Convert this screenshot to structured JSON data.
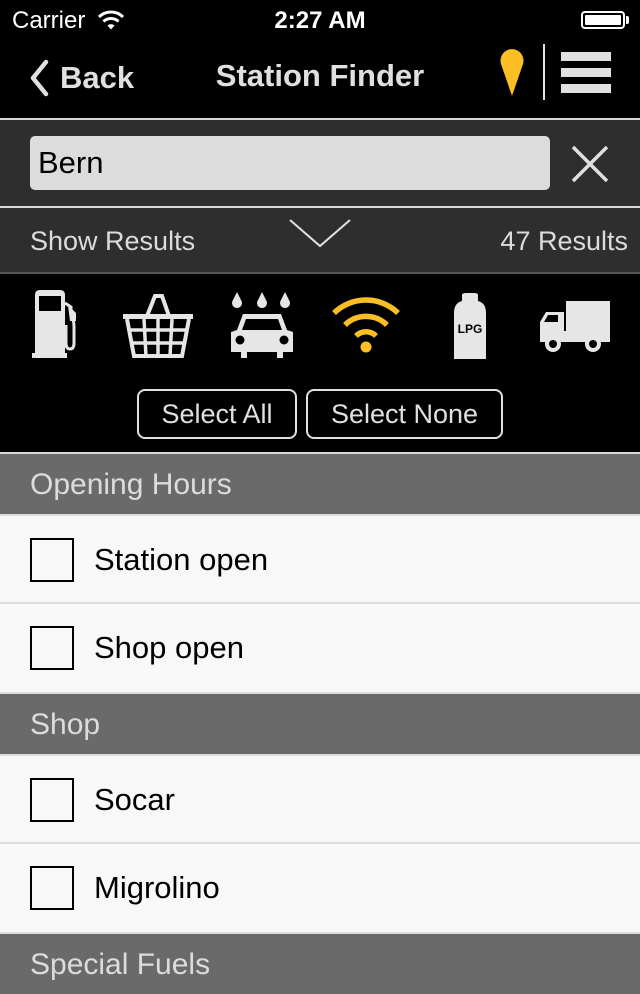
{
  "status_bar": {
    "carrier": "Carrier",
    "time": "2:27 AM",
    "battery_level": 1.0
  },
  "nav": {
    "back_label": "Back",
    "title": "Station Finder",
    "icons": [
      "chevron-left-icon",
      "map-pin-icon",
      "hamburger-menu-icon"
    ],
    "accent_color": "#fbbf23"
  },
  "search": {
    "value": "Bern",
    "placeholder": "",
    "clear_icon": "close-icon"
  },
  "results_bar": {
    "toggle_label": "Show Results",
    "count_label": "47 Results",
    "toggle_icon": "chevron-down-icon"
  },
  "filters": {
    "icons": [
      {
        "name": "fuel-pump-icon",
        "selected": false
      },
      {
        "name": "shopping-basket-icon",
        "selected": false
      },
      {
        "name": "car-wash-icon",
        "selected": false
      },
      {
        "name": "wifi-icon",
        "selected": true
      },
      {
        "name": "lpg-icon",
        "label": "LPG",
        "selected": false
      },
      {
        "name": "truck-icon",
        "selected": false
      }
    ],
    "select_all_label": "Select All",
    "select_none_label": "Select None",
    "selected_color": "#fbbf23",
    "unselected_color": "#e6e6e6"
  },
  "sections": [
    {
      "title": "Opening Hours",
      "items": [
        {
          "label": "Station open",
          "checked": false
        },
        {
          "label": "Shop open",
          "checked": false
        }
      ]
    },
    {
      "title": "Shop",
      "items": [
        {
          "label": "Socar",
          "checked": false
        },
        {
          "label": "Migrolino",
          "checked": false
        }
      ]
    },
    {
      "title": "Special Fuels",
      "items": []
    }
  ]
}
